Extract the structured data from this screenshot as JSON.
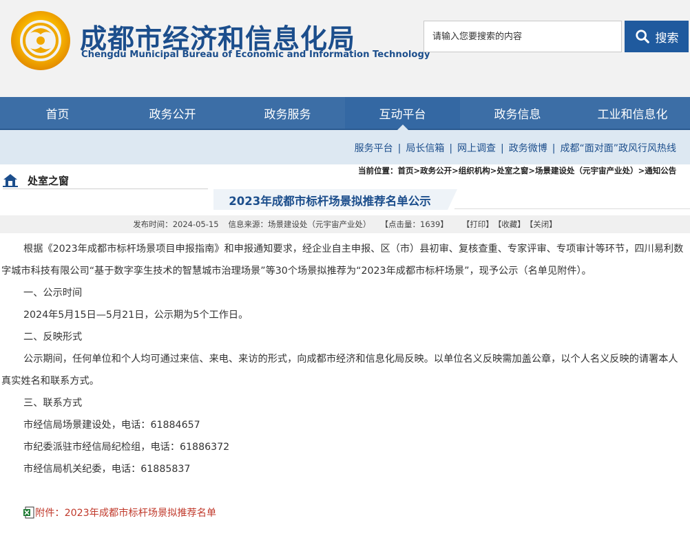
{
  "header": {
    "logo_cn": "成都市经济和信息化局",
    "logo_en": "Chengdu Municipal Bureau of Economic and Information Technology",
    "search": {
      "placeholder": "请输入您要搜索的内容",
      "button_label": "搜索"
    }
  },
  "nav": {
    "items": [
      {
        "label": "首页"
      },
      {
        "label": "政务公开"
      },
      {
        "label": "政务服务"
      },
      {
        "label": "互动平台"
      },
      {
        "label": "政务信息"
      },
      {
        "label": "工业和信息化"
      }
    ],
    "active_index": 3
  },
  "subnav": {
    "links": [
      "服务平台",
      "局长信箱",
      "网上调查",
      "政务微博",
      "成都“面对面”政风行风热线"
    ],
    "separator": "|"
  },
  "sidebar": {
    "section_title": "处室之窗"
  },
  "breadcrumb": {
    "prefix": "当前位置：",
    "items": [
      "首页",
      "政务公开",
      "组织机构",
      "处室之窗",
      "场景建设处（元宇宙产业处）",
      "通知公告"
    ],
    "separator": ">"
  },
  "article": {
    "title": "2023年成都市标杆场景拟推荐名单公示",
    "meta": {
      "publish_label": "发布时间：",
      "publish_date": "2024-05-15",
      "source_label": "信息来源：",
      "source": "场景建设处（元宇宙产业处）",
      "clicks_label": "【点击量：",
      "clicks": "1639",
      "clicks_suffix": "】",
      "print": "【打印】",
      "favorite": "【收藏】",
      "close": "【关闭】"
    },
    "paragraphs": [
      "根据《2023年成都市标杆场景项目申报指南》和申报通知要求，经企业自主申报、区（市）县初审、复核查重、专家评审、专项审计等环节，四川易利数字城市科技有限公司“基于数字孪生技术的智慧城市治理场景”等30个场景拟推荐为“2023年成都市标杆场景”，现予公示（名单见附件）。",
      "一、公示时间",
      "2024年5月15日—5月21日，公示期为5个工作日。",
      "二、反映形式",
      "公示期间，任何单位和个人均可通过来信、来电、来访的形式，向成都市经济和信息化局反映。以单位名义反映需加盖公章，以个人名义反映的请署本人真实姓名和联系方式。",
      "三、联系方式",
      "市经信局场景建设处，电话：61884657",
      "市纪委派驻市经信局纪检组，电话：61886372",
      "市经信局机关纪委，电话：61885837"
    ],
    "attachment": "附件：2023年成都市标杆场景拟推荐名单"
  },
  "colors": {
    "brand_blue": "#1c4e8c",
    "nav_bg": "#3c6ea6",
    "subnav_bg": "#dde8f2",
    "attachment_red": "#c0392b"
  },
  "icons": [
    "logo-emblem",
    "search-icon",
    "home-icon",
    "excel-file-icon"
  ]
}
